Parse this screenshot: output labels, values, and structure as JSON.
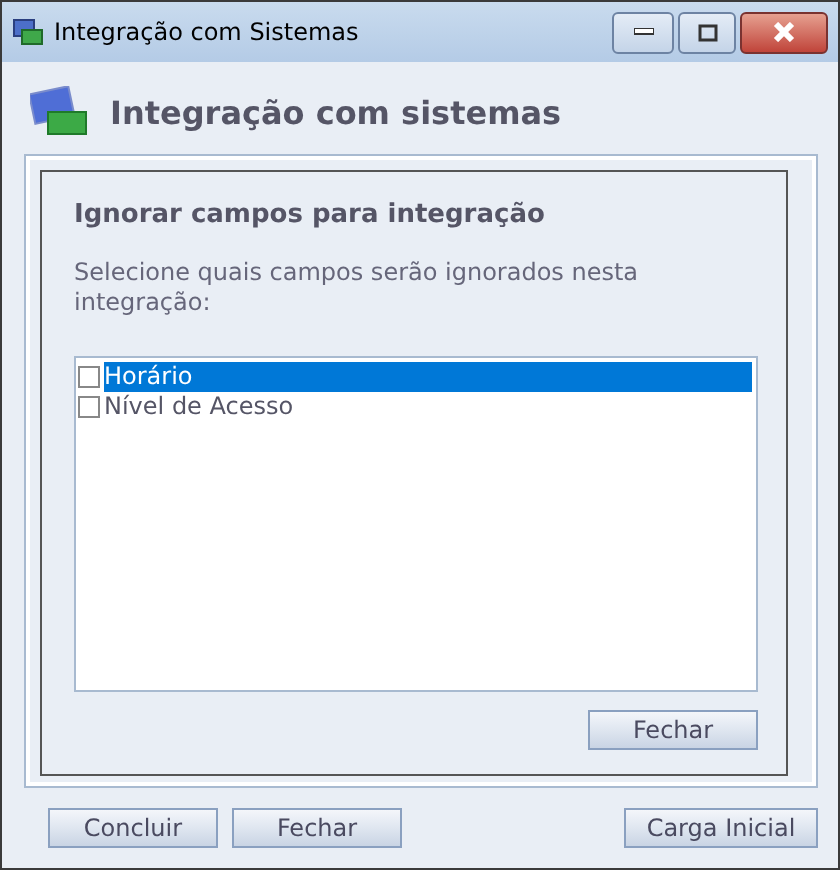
{
  "window": {
    "title": "Integração com Sistemas"
  },
  "header": {
    "title": "Integração com sistemas"
  },
  "panel": {
    "title": "Ignorar campos para integração",
    "description": "Selecione quais campos serão ignorados nesta integração:",
    "fields": [
      {
        "label": "Horário",
        "checked": false,
        "selected": true
      },
      {
        "label": "Nível de Acesso",
        "checked": false,
        "selected": false
      }
    ],
    "close_button": "Fechar"
  },
  "buttons": {
    "left": [
      "Concluir",
      "Fechar"
    ],
    "right": [
      "Carga Inicial"
    ]
  }
}
